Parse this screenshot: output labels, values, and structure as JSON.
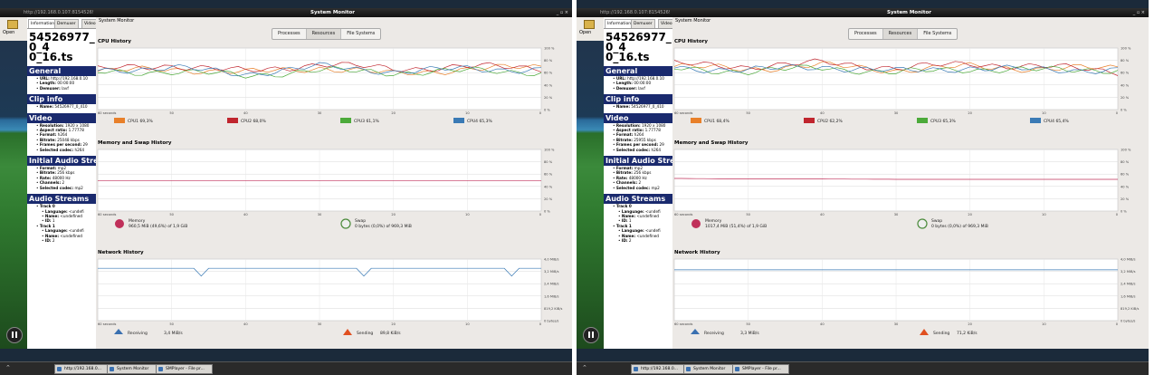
{
  "screens": [
    {
      "topbar": {
        "url_tab": "http://192.168.0.107:8154526977",
        "title": "System Monitor",
        "window_controls": "_ ▫ ×"
      },
      "open_label": "Open",
      "player": {
        "tabs": [
          "Information",
          "Demuxer",
          "Video"
        ],
        "file_title": "54526977_0_4\n0_16.ts",
        "sections": [
          {
            "title": "General",
            "rows": [
              {
                "k": "URL",
                "v": "http://192.168.0.10"
              },
              {
                "k": "Length",
                "v": "00:00:00"
              },
              {
                "k": "Demuxer",
                "v": "lavf"
              }
            ]
          },
          {
            "title": "Clip info",
            "rows": [
              {
                "k": "Name",
                "v": "54526977_0_410"
              }
            ]
          },
          {
            "title": "Video",
            "rows": [
              {
                "k": "Resolution",
                "v": "1920 x 1080"
              },
              {
                "k": "Aspect ratio",
                "v": "1.77778"
              },
              {
                "k": "Format",
                "v": "h264"
              },
              {
                "k": "Bitrate",
                "v": "25048 kbps"
              },
              {
                "k": "Frames per second",
                "v": "29"
              },
              {
                "k": "Selected codec",
                "v": "h264"
              }
            ]
          },
          {
            "title": "Initial Audio Stream",
            "rows": [
              {
                "k": "Format",
                "v": "mp2"
              },
              {
                "k": "Bitrate",
                "v": "256 kbps"
              },
              {
                "k": "Rate",
                "v": "48000 Hz"
              },
              {
                "k": "Channels",
                "v": "2"
              },
              {
                "k": "Selected codec",
                "v": "mp2"
              }
            ]
          },
          {
            "title": "Audio Streams",
            "tracks": [
              {
                "label": "Track 0",
                "rows": [
                  {
                    "k": "Language",
                    "v": "<undefi"
                  },
                  {
                    "k": "Name",
                    "v": "<undefined"
                  },
                  {
                    "k": "ID",
                    "v": "1"
                  }
                ]
              },
              {
                "label": "Track 1",
                "rows": [
                  {
                    "k": "Language",
                    "v": "<undefi"
                  },
                  {
                    "k": "Name",
                    "v": "<undefined"
                  },
                  {
                    "k": "ID",
                    "v": "2"
                  }
                ]
              }
            ]
          }
        ]
      },
      "sysmon": {
        "menu": "System Monitor",
        "tabs": [
          "Processes",
          "Resources",
          "File Systems"
        ],
        "active_tab": 1,
        "cpu": {
          "title": "CPU History",
          "y_ticks": [
            "100 %",
            "80 %",
            "60 %",
            "40 %",
            "20 %",
            "0 %"
          ],
          "x_ticks": [
            "60 seconds",
            "50",
            "40",
            "30",
            "20",
            "10",
            "0"
          ],
          "legend": [
            {
              "label": "CPU1 69,3%",
              "color": "#e8802a"
            },
            {
              "label": "CPU2 68,0%",
              "color": "#c0252e"
            },
            {
              "label": "CPU3 61,1%",
              "color": "#4caa3a"
            },
            {
              "label": "CPU4 65,3%",
              "color": "#3a7ab5"
            }
          ]
        },
        "memory": {
          "title": "Memory and Swap History",
          "y_ticks": [
            "100 %",
            "80 %",
            "60 %",
            "40 %",
            "20 %",
            "0 %"
          ],
          "x_ticks": [
            "60 seconds",
            "50",
            "40",
            "30",
            "20",
            "10",
            "0"
          ],
          "memory_label": "Memory",
          "memory_value": "960,5 MiB (49,6%) of 1,9 GiB",
          "swap_label": "Swap",
          "swap_value": "0 bytes (0,0%) of 969,3 MiB"
        },
        "network": {
          "title": "Network History",
          "y_ticks": [
            "4,0 MiB/s",
            "3,2 MiB/s",
            "2,4 MiB/s",
            "1,6 MiB/s",
            "819,2 KiB/s",
            "0 bytes/s"
          ],
          "x_ticks": [
            "60 seconds",
            "50",
            "40",
            "30",
            "20",
            "10",
            "0"
          ],
          "receiving_label": "Receiving",
          "receiving_value": "3,4 MiB/s",
          "sending_label": "Sending",
          "sending_value": "89,8 KiB/s"
        }
      },
      "taskbar": [
        {
          "label": "http://192.168.0..."
        },
        {
          "label": "System Monitor"
        },
        {
          "label": "SMPlayer - File pr..."
        }
      ]
    },
    {
      "topbar": {
        "url_tab": "http://192.168.0.107:8154526977",
        "title": "System Monitor",
        "window_controls": "_ ▫ ×"
      },
      "open_label": "Open",
      "player": {
        "tabs": [
          "Information",
          "Demuxer",
          "Video"
        ],
        "file_title": "54526977_0_4\n0_16.ts",
        "sections": [
          {
            "title": "General",
            "rows": [
              {
                "k": "URL",
                "v": "http://192.168.0.10"
              },
              {
                "k": "Length",
                "v": "00:00:00"
              },
              {
                "k": "Demuxer",
                "v": "lavf"
              }
            ]
          },
          {
            "title": "Clip info",
            "rows": [
              {
                "k": "Name",
                "v": "54526977_0_410"
              }
            ]
          },
          {
            "title": "Video",
            "rows": [
              {
                "k": "Resolution",
                "v": "1920 x 1080"
              },
              {
                "k": "Aspect ratio",
                "v": "1.77778"
              },
              {
                "k": "Format",
                "v": "h264"
              },
              {
                "k": "Bitrate",
                "v": "25955 kbps"
              },
              {
                "k": "Frames per second",
                "v": "29"
              },
              {
                "k": "Selected codec",
                "v": "h264"
              }
            ]
          },
          {
            "title": "Initial Audio Stream",
            "rows": [
              {
                "k": "Format",
                "v": "mp2"
              },
              {
                "k": "Bitrate",
                "v": "256 kbps"
              },
              {
                "k": "Rate",
                "v": "48000 Hz"
              },
              {
                "k": "Channels",
                "v": "2"
              },
              {
                "k": "Selected codec",
                "v": "mp2"
              }
            ]
          },
          {
            "title": "Audio Streams",
            "tracks": [
              {
                "label": "Track 0",
                "rows": [
                  {
                    "k": "Language",
                    "v": "<undefi"
                  },
                  {
                    "k": "Name",
                    "v": "<undefined"
                  },
                  {
                    "k": "ID",
                    "v": "1"
                  }
                ]
              },
              {
                "label": "Track 1",
                "rows": [
                  {
                    "k": "Language",
                    "v": "<undefi"
                  },
                  {
                    "k": "Name",
                    "v": "<undefined"
                  },
                  {
                    "k": "ID",
                    "v": "2"
                  }
                ]
              }
            ]
          }
        ]
      },
      "sysmon": {
        "menu": "System Monitor",
        "tabs": [
          "Processes",
          "Resources",
          "File Systems"
        ],
        "active_tab": 1,
        "cpu": {
          "title": "CPU History",
          "y_ticks": [
            "100 %",
            "80 %",
            "60 %",
            "40 %",
            "20 %",
            "0 %"
          ],
          "x_ticks": [
            "60 seconds",
            "50",
            "40",
            "30",
            "20",
            "10",
            "0"
          ],
          "legend": [
            {
              "label": "CPU1 68,4%",
              "color": "#e8802a"
            },
            {
              "label": "CPU2 62,2%",
              "color": "#c0252e"
            },
            {
              "label": "CPU3 65,3%",
              "color": "#4caa3a"
            },
            {
              "label": "CPU4 65,4%",
              "color": "#3a7ab5"
            }
          ]
        },
        "memory": {
          "title": "Memory and Swap History",
          "y_ticks": [
            "100 %",
            "80 %",
            "60 %",
            "40 %",
            "20 %",
            "0 %"
          ],
          "x_ticks": [
            "60 seconds",
            "50",
            "40",
            "30",
            "20",
            "10",
            "0"
          ],
          "memory_label": "Memory",
          "memory_value": "1017,4 MiB (51,4%) of 1,9 GiB",
          "swap_label": "Swap",
          "swap_value": "0 bytes (0,0%) of 969,3 MiB"
        },
        "network": {
          "title": "Network History",
          "y_ticks": [
            "4,0 MiB/s",
            "3,2 MiB/s",
            "2,4 MiB/s",
            "1,6 MiB/s",
            "819,2 KiB/s",
            "0 bytes/s"
          ],
          "x_ticks": [
            "60 seconds",
            "50",
            "40",
            "30",
            "20",
            "10",
            "0"
          ],
          "receiving_label": "Receiving",
          "receiving_value": "3,3 MiB/s",
          "sending_label": "Sending",
          "sending_value": "71,2 KiB/s"
        }
      },
      "taskbar": [
        {
          "label": "http://192.168.0..."
        },
        {
          "label": "System Monitor"
        },
        {
          "label": "SMPlayer - File pr..."
        }
      ]
    }
  ],
  "chart_data": [
    {
      "type": "line",
      "title": "CPU History",
      "x_unit": "seconds ago",
      "x": [
        60,
        50,
        40,
        30,
        20,
        10,
        0
      ],
      "ylim": [
        0,
        100
      ],
      "series": [
        {
          "name": "CPU1 69,3%",
          "values": [
            62,
            66,
            60,
            68,
            58,
            66,
            69
          ]
        },
        {
          "name": "CPU2 68,0%",
          "values": [
            65,
            72,
            62,
            74,
            66,
            70,
            68
          ]
        },
        {
          "name": "CPU3 61,1%",
          "values": [
            60,
            62,
            55,
            64,
            60,
            63,
            61
          ]
        },
        {
          "name": "CPU4 65,3%",
          "values": [
            64,
            68,
            58,
            70,
            62,
            66,
            65
          ]
        }
      ]
    },
    {
      "type": "line",
      "title": "Memory and Swap History",
      "x": [
        60,
        50,
        40,
        30,
        20,
        10,
        0
      ],
      "ylim": [
        0,
        100
      ],
      "series": [
        {
          "name": "Memory",
          "values": [
            49.6,
            49.6,
            49.6,
            49.6,
            49.6,
            49.6,
            49.6
          ]
        },
        {
          "name": "Swap",
          "values": [
            0,
            0,
            0,
            0,
            0,
            0,
            0
          ]
        }
      ]
    },
    {
      "type": "line",
      "title": "Network History",
      "x": [
        60,
        50,
        40,
        30,
        20,
        10,
        0
      ],
      "ylim": [
        0,
        4.0
      ],
      "y_unit": "MiB/s",
      "series": [
        {
          "name": "Receiving",
          "values": [
            3.4,
            3.4,
            3.4,
            3.4,
            3.4,
            3.4,
            3.4
          ]
        },
        {
          "name": "Sending",
          "values": [
            0.09,
            0.09,
            0.09,
            0.09,
            0.09,
            0.09,
            0.09
          ]
        }
      ]
    },
    {
      "type": "line",
      "title": "CPU History",
      "x_unit": "seconds ago",
      "x": [
        60,
        50,
        40,
        30,
        20,
        10,
        0
      ],
      "ylim": [
        0,
        100
      ],
      "series": [
        {
          "name": "CPU1 68,4%",
          "values": [
            70,
            66,
            72,
            64,
            70,
            66,
            68
          ]
        },
        {
          "name": "CPU2 62,2%",
          "values": [
            74,
            70,
            76,
            68,
            74,
            70,
            62
          ]
        },
        {
          "name": "CPU3 65,3%",
          "values": [
            66,
            62,
            68,
            60,
            66,
            64,
            65
          ]
        },
        {
          "name": "CPU4 65,4%",
          "values": [
            68,
            64,
            70,
            62,
            68,
            64,
            65
          ]
        }
      ]
    },
    {
      "type": "line",
      "title": "Memory and Swap History",
      "x": [
        60,
        50,
        40,
        30,
        20,
        10,
        0
      ],
      "ylim": [
        0,
        100
      ],
      "series": [
        {
          "name": "Memory",
          "values": [
            53,
            52,
            52,
            51.5,
            51.5,
            51.4,
            51.4
          ]
        },
        {
          "name": "Swap",
          "values": [
            0,
            0,
            0,
            0,
            0,
            0,
            0
          ]
        }
      ]
    },
    {
      "type": "line",
      "title": "Network History",
      "x": [
        60,
        50,
        40,
        30,
        20,
        10,
        0
      ],
      "ylim": [
        0,
        4.0
      ],
      "y_unit": "MiB/s",
      "series": [
        {
          "name": "Receiving",
          "values": [
            3.3,
            3.3,
            3.3,
            3.3,
            3.3,
            3.3,
            3.3
          ]
        },
        {
          "name": "Sending",
          "values": [
            0.07,
            0.07,
            0.07,
            0.07,
            0.07,
            0.07,
            0.07
          ]
        }
      ]
    }
  ]
}
